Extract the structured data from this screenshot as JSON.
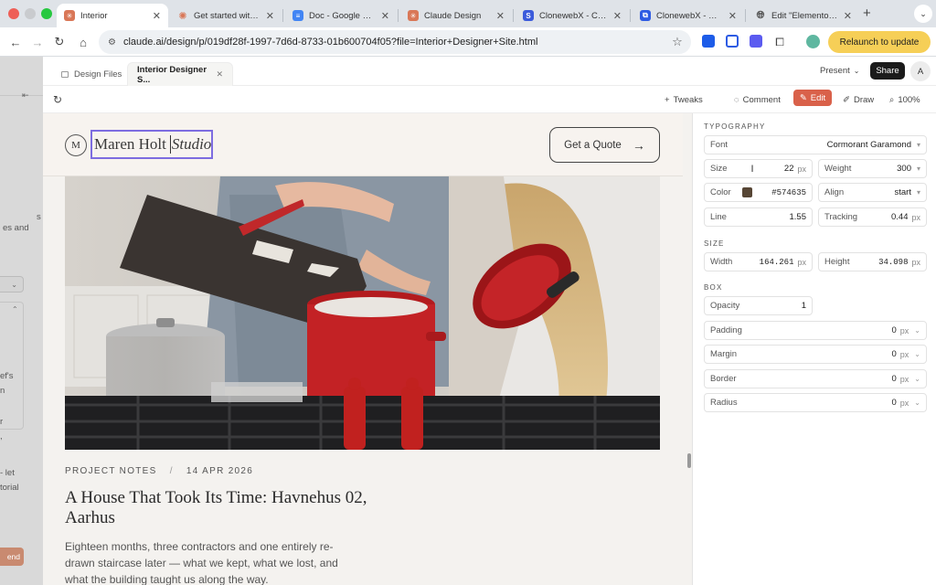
{
  "browser": {
    "tabs": [
      {
        "title": "Interior",
        "active": true
      },
      {
        "title": "Get started with Cl"
      },
      {
        "title": "Doc - Google Docs"
      },
      {
        "title": "Claude Design"
      },
      {
        "title": "ClonewebX - Clone"
      },
      {
        "title": "ClonewebX - Softw"
      },
      {
        "title": "Edit \"Elementor #"
      }
    ],
    "new_tab": "+",
    "url": "claude.ai/design/p/019df28f-1997-7d6d-8733-01b600704f05?file=Interior+Designer+Site.html",
    "relaunch_label": "Relaunch to update",
    "avatar_initial": "A",
    "colors": {
      "relaunch": "#f6cf57",
      "edit": "#d9614a",
      "selection": "#7d6ce0"
    }
  },
  "app": {
    "tabs": [
      {
        "label": "Design Files"
      },
      {
        "label": "Interior Designer S..."
      }
    ],
    "present_label": "Present",
    "share_label": "Share",
    "user_initial": "A",
    "toolbar": {
      "tweaks": "Tweaks",
      "comment": "Comment",
      "edit": "Edit",
      "draw": "Draw",
      "zoom": "100%"
    },
    "left_panel_fragments": [
      "s",
      "es and",
      "ef's",
      "n",
      "r",
      ",",
      "- let",
      "torial",
      "end"
    ]
  },
  "site": {
    "logo_initial": "M",
    "brand_name": "Maren Holt",
    "brand_suffix": "Studio",
    "cta": "Get a Quote",
    "meta_category": "PROJECT NOTES",
    "meta_sep": "/",
    "meta_date": "14 APR 2026",
    "headline": "A House That Took Its Time: Havnehus 02, Aarhus",
    "excerpt": "Eighteen months, three contractors and one entirely re-drawn staircase later — what we kept, what we lost, and what the building taught us along the way."
  },
  "inspector": {
    "typography": {
      "section": "TYPOGRAPHY",
      "font_label": "Font",
      "font_value": "Cormorant Garamond",
      "size_label": "Size",
      "size_value": "22",
      "size_unit": "px",
      "weight_label": "Weight",
      "weight_value": "300",
      "color_label": "Color",
      "color_value": "#574635",
      "align_label": "Align",
      "align_value": "start",
      "line_label": "Line",
      "line_value": "1.55",
      "tracking_label": "Tracking",
      "tracking_value": "0.44",
      "tracking_unit": "px"
    },
    "size": {
      "section": "SIZE",
      "width_label": "Width",
      "width_value": "164.261",
      "width_unit": "px",
      "height_label": "Height",
      "height_value": "34.098",
      "height_unit": "px"
    },
    "box": {
      "section": "BOX",
      "opacity_label": "Opacity",
      "opacity_value": "1",
      "padding_label": "Padding",
      "padding_value": "0",
      "padding_unit": "px",
      "margin_label": "Margin",
      "margin_value": "0",
      "margin_unit": "px",
      "border_label": "Border",
      "border_value": "0",
      "border_unit": "px",
      "radius_label": "Radius",
      "radius_value": "0",
      "radius_unit": "px"
    }
  }
}
